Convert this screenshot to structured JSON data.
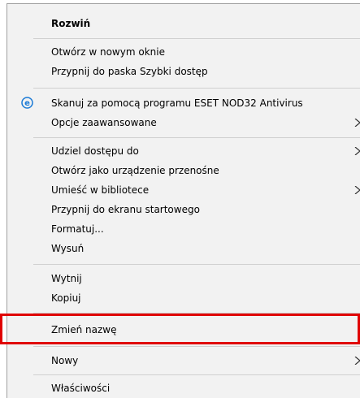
{
  "context_menu": {
    "items": [
      {
        "label": "Rozwiń",
        "bold": true
      },
      {
        "label": "Otwórz w nowym oknie"
      },
      {
        "label": "Przypnij do paska Szybki dostęp"
      },
      {
        "label": "Skanuj za pomocą programu ESET NOD32 Antivirus",
        "icon": "eset-icon"
      },
      {
        "label": "Opcje zaawansowane",
        "submenu": true
      },
      {
        "label": "Udziel dostępu do",
        "submenu": true
      },
      {
        "label": "Otwórz jako urządzenie przenośne"
      },
      {
        "label": "Umieść w bibliotece",
        "submenu": true
      },
      {
        "label": "Przypnij do ekranu startowego"
      },
      {
        "label": "Formatuj..."
      },
      {
        "label": "Wysuń"
      },
      {
        "label": "Wytnij"
      },
      {
        "label": "Kopiuj"
      },
      {
        "label": "Zmień nazwę",
        "highlighted": true
      },
      {
        "label": "Nowy",
        "submenu": true
      },
      {
        "label": "Właściwości"
      }
    ],
    "icons": {
      "eset": "e"
    },
    "colors": {
      "highlight_border": "#e00000",
      "eset_icon": "#1a7ad6",
      "menu_background": "#f2f2f2"
    }
  }
}
